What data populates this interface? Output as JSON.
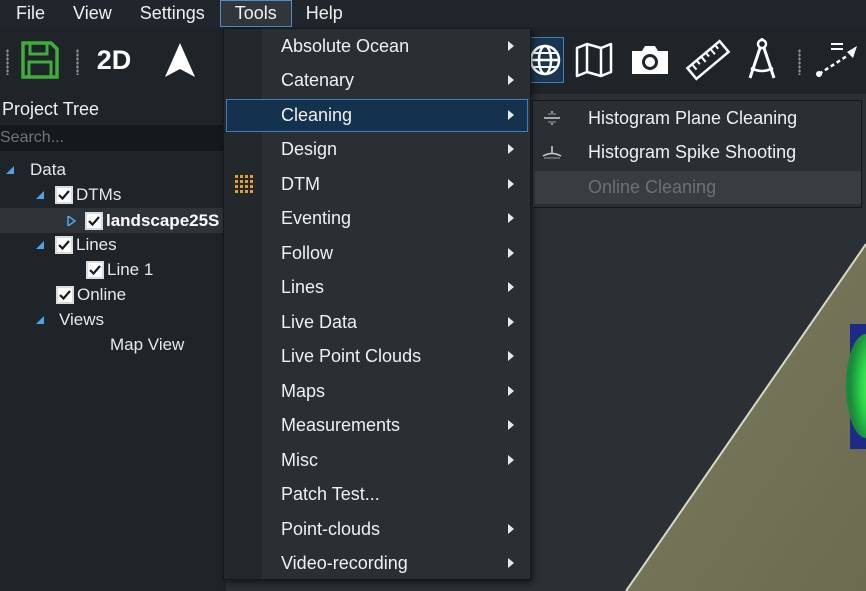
{
  "menubar": {
    "items": [
      "File",
      "View",
      "Settings",
      "Tools",
      "Help"
    ]
  },
  "toolbar": {
    "mode_label": "2D",
    "icons": [
      "save-icon",
      "navigate-arrow-icon",
      "globe-icon",
      "map-icon",
      "camera-icon",
      "ruler-icon",
      "compass-icon",
      "pointer-line-icon"
    ]
  },
  "project_tree": {
    "title": "Project Tree",
    "search_placeholder": "Search...",
    "nodes": {
      "data": "Data",
      "dtms": "DTMs",
      "landscape": "landscape25S",
      "lines": "Lines",
      "line1": "Line 1",
      "online": "Online",
      "views": "Views",
      "map_view": "Map View"
    }
  },
  "tools_menu": {
    "items": [
      {
        "label": "Absolute Ocean",
        "submenu": true
      },
      {
        "label": "Catenary",
        "submenu": true
      },
      {
        "label": "Cleaning",
        "submenu": true,
        "active": true
      },
      {
        "label": "Design",
        "submenu": true
      },
      {
        "label": "DTM",
        "submenu": true,
        "icon": "dtm-grid-icon"
      },
      {
        "label": "Eventing",
        "submenu": true
      },
      {
        "label": "Follow",
        "submenu": true
      },
      {
        "label": "Lines",
        "submenu": true
      },
      {
        "label": "Live Data",
        "submenu": true
      },
      {
        "label": "Live Point Clouds",
        "submenu": true
      },
      {
        "label": "Maps",
        "submenu": true
      },
      {
        "label": "Measurements",
        "submenu": true
      },
      {
        "label": "Misc",
        "submenu": true
      },
      {
        "label": "Patch Test...",
        "submenu": false
      },
      {
        "label": "Point-clouds",
        "submenu": true
      },
      {
        "label": "Video-recording",
        "submenu": true
      }
    ]
  },
  "cleaning_submenu": {
    "items": [
      {
        "label": "Histogram Plane Cleaning",
        "icon": "histogram-plane-icon",
        "enabled": true
      },
      {
        "label": "Histogram Spike Shooting",
        "icon": "spike-shooting-icon",
        "enabled": true
      },
      {
        "label": "Online Cleaning",
        "enabled": false
      }
    ]
  },
  "colors": {
    "accent": "#3d7fbf",
    "menu_bg": "#2a2f33",
    "save_green": "#3fae3a",
    "dtm_orange": "#e0a030"
  }
}
